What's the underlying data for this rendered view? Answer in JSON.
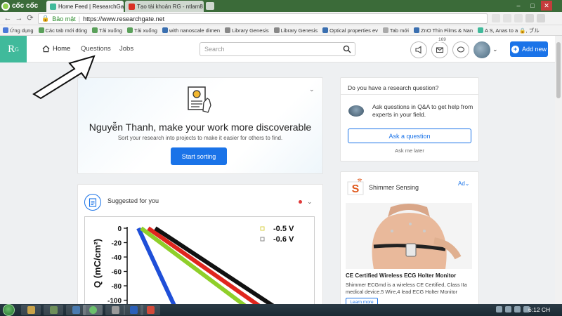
{
  "browser": {
    "brand": "cốc cốc",
    "tabs": [
      {
        "title": "Home Feed | ResearchGat",
        "active": true
      },
      {
        "title": "Tạo tài khoản RG - ntlam8",
        "active": false
      }
    ],
    "security_label": "Bảo mật",
    "url": "https://www.researchgate.net",
    "bookmarks": [
      {
        "label": "Ứng dụng",
        "icon": "apps-icon"
      },
      {
        "label": "Các tab mới đóng",
        "icon": "history-icon"
      },
      {
        "label": "Tải xuống",
        "icon": "download-icon"
      },
      {
        "label": "Tải xuống",
        "icon": "download-icon"
      },
      {
        "label": "with nanoscale dimen",
        "icon": "page-icon"
      },
      {
        "label": "Library Genesis",
        "icon": "libgen-icon"
      },
      {
        "label": "Library Genesis",
        "icon": "libgen-icon"
      },
      {
        "label": "Optical properties ev",
        "icon": "page-icon"
      },
      {
        "label": "Tab mới",
        "icon": "doc-icon"
      },
      {
        "label": "ZnO Thin Films & Nan",
        "icon": "page-icon"
      },
      {
        "label": "A S, Anas to a 🔒, ブル",
        "icon": "rg-icon"
      }
    ]
  },
  "rg_nav": {
    "logo": "R",
    "logo_sup": "G",
    "home": "Home",
    "questions": "Questions",
    "jobs": "Jobs",
    "search_placeholder": "Search",
    "notifications_count": "169",
    "add_new": "Add new"
  },
  "hero": {
    "title": "Nguyễn Thanh, make your work more discoverable",
    "subtitle": "Sort your research into projects to make it easier for others to find.",
    "button": "Start sorting"
  },
  "suggested": {
    "label": "Suggested for you"
  },
  "chart_data": {
    "type": "line",
    "ylabel": "Q (mC/cm²)",
    "yticks": [
      "0",
      "-20",
      "-40",
      "-60",
      "-80",
      "-100"
    ],
    "ylim": [
      -100,
      0
    ],
    "legend": [
      {
        "label": "-0.5 V",
        "color": "#d8d24a"
      },
      {
        "label": "-0.6 V",
        "color": "#888888"
      }
    ],
    "series": [
      {
        "color": "#1f4fd8"
      },
      {
        "color": "#8fcf2a"
      },
      {
        "color": "#e0261e"
      },
      {
        "color": "#111111"
      }
    ]
  },
  "question_card": {
    "title": "Do you have a research question?",
    "text": "Ask questions in Q&A to get help from experts in your field.",
    "button": "Ask a question",
    "later": "Ask me later"
  },
  "ad": {
    "label": "Ad",
    "brand": "Shimmer Sensing",
    "title": "CE Certified Wireless ECG Holter Monitor",
    "description": "Shimmer ECGmd is a wireless CE Certified, Class IIa medical device.5 Wire,4 lead ECG Holter Monitor",
    "learn_more": "Learn more"
  },
  "taskbar": {
    "clock": "6:12 CH"
  },
  "colors": {
    "rg_teal": "#40ba9b",
    "primary_blue": "#1a73e8",
    "browser_green": "#3b6b39"
  }
}
